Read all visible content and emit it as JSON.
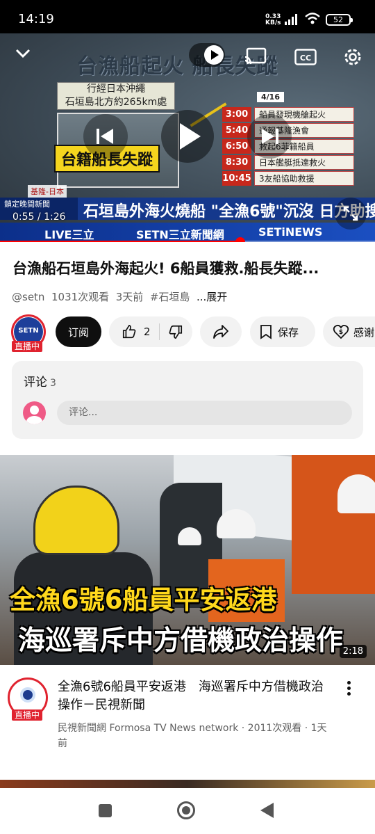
{
  "status_bar": {
    "time": "14:19",
    "net_speed": "0.33",
    "net_unit": "KB/s",
    "battery": "52"
  },
  "player": {
    "overlay_title": "台漁船起火 船長失蹤",
    "route_note_line1": "行經日本沖繩",
    "route_note_line2": "石垣島北方約265km處",
    "photo_label": "台籍船長失蹤",
    "location": "基隆-日本",
    "date_tag": "4/16",
    "timeline": [
      {
        "time": "3:00",
        "event": "船員發現機艙起火"
      },
      {
        "time": "5:40",
        "event": "通報基隆漁會"
      },
      {
        "time": "6:50",
        "event": "救起6菲籍船員"
      },
      {
        "time": "8:30",
        "event": "日本艦艇抵達救火"
      },
      {
        "time": "10:45",
        "event": "3友船協助救援"
      }
    ],
    "band_tag": "鎖定晚間新聞",
    "band_text": "石垣島外海火燒船 \"全漁6號\"沉沒 日方助搜救",
    "logo_band": [
      "LIVE三立",
      "SETN三立新聞網",
      "SETiNEWS"
    ],
    "current_time": "0:55",
    "duration": "1:26",
    "progress": 0.64,
    "cc_label": "CC"
  },
  "video": {
    "title": "台漁船石垣島外海起火! 6船員獲救.船長失蹤...",
    "channel_handle": "@setn",
    "views": "1031次观看",
    "age": "3天前",
    "hashtag": "#石垣島",
    "more": "...展开"
  },
  "channel": {
    "logo_text": "SETN",
    "live_badge": "直播中"
  },
  "actions": {
    "subscribe": "订阅",
    "likes": "2",
    "save": "保存",
    "thanks": "感谢"
  },
  "comments": {
    "label": "评论",
    "count": "3",
    "placeholder": "评论..."
  },
  "next_video": {
    "caption_line1": "全漁6號6船員平安返港",
    "caption_line2": "海巡署斥中方借機政治操作",
    "duration": "2:18",
    "title": "全漁6號6船員平安返港　海巡署斥中方借機政治操作－民視新聞",
    "meta": "民視新聞網 Formosa TV News network · 2011次观看 · 1天前",
    "live_badge": "直播中"
  }
}
